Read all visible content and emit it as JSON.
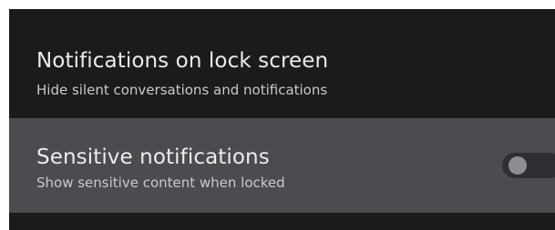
{
  "settings": {
    "lock_screen": {
      "title": "Notifications on lock screen",
      "subtitle": "Hide silent conversations and notifications"
    },
    "sensitive": {
      "title": "Sensitive notifications",
      "subtitle": "Show sensitive content when locked",
      "toggle_on": false
    }
  },
  "colors": {
    "background": "#1b1b1c",
    "highlight_row": "#4c4b4f",
    "text_primary": "#ececec",
    "text_secondary": "#c9c9cb",
    "switch_track": "#2f2e31",
    "switch_thumb": "#8e8d91"
  }
}
